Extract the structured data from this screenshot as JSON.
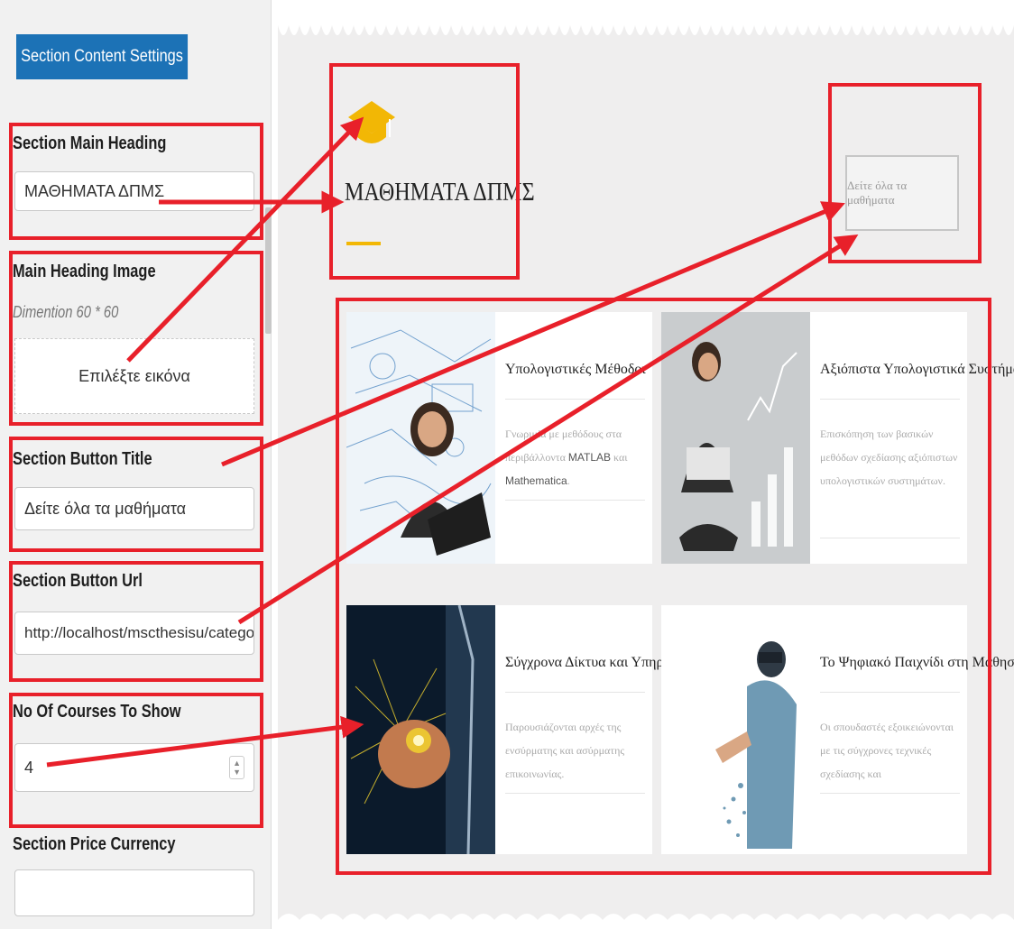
{
  "settings": {
    "section_button": "Section Content Settings",
    "main_heading_label": "Section Main Heading",
    "main_heading_value": "ΜΑΘΗΜΑΤΑ ΔΠΜΣ",
    "heading_image_label": "Main Heading Image",
    "heading_image_hint": "Dimention 60 * 60",
    "choose_image": "Επιλέξτε εικόνα",
    "button_title_label": "Section Button Title",
    "button_title_value": "Δείτε όλα τα μαθήματα",
    "button_url_label": "Section Button Url",
    "button_url_value": "http://localhost/mscthesisu/category/lessons",
    "courses_count_label": "No Of Courses To Show",
    "courses_count_value": "4",
    "price_currency_label": "Section Price Currency",
    "price_currency_value": ""
  },
  "preview": {
    "heading": "ΜΑΘΗΜΑΤΑ ΔΠΜΣ",
    "see_all_button": "Δείτε όλα τα μαθήματα",
    "heading_icon": "graduation-cap-icon",
    "accent_color": "#f2b705",
    "courses": [
      {
        "title": "Υπολογιστικές Μέθοδοι",
        "desc_pre": "Γνωριμία με μεθόδους στα περιβάλλοντα ",
        "desc_em": "MATLAB",
        "desc_mid": " και ",
        "desc_em2": "Mathematica",
        "desc_post": "."
      },
      {
        "title": "Αξιόπιστα Υπολογιστικά Συστήματα",
        "desc": "Επισκόπηση των βασικών μεθόδων σχεδίασης αξιόπιστων υπολογιστικών συστημάτων."
      },
      {
        "title": "Σύγχρονα Δίκτυα και Υπηρεσίες",
        "desc": "Παρουσιάζονται αρχές της ενσύρματης και ασύρματης επικοινωνίας."
      },
      {
        "title": "Το Ψηφιακό Παιχνίδι στη Μάθηση",
        "desc": "Οι σπουδαστές εξοικειώνονται με τις σύγχρονες τεχνικές σχεδίασης και"
      }
    ]
  },
  "colors": {
    "highlight": "#e8202a",
    "button_blue": "#1c72b6"
  }
}
